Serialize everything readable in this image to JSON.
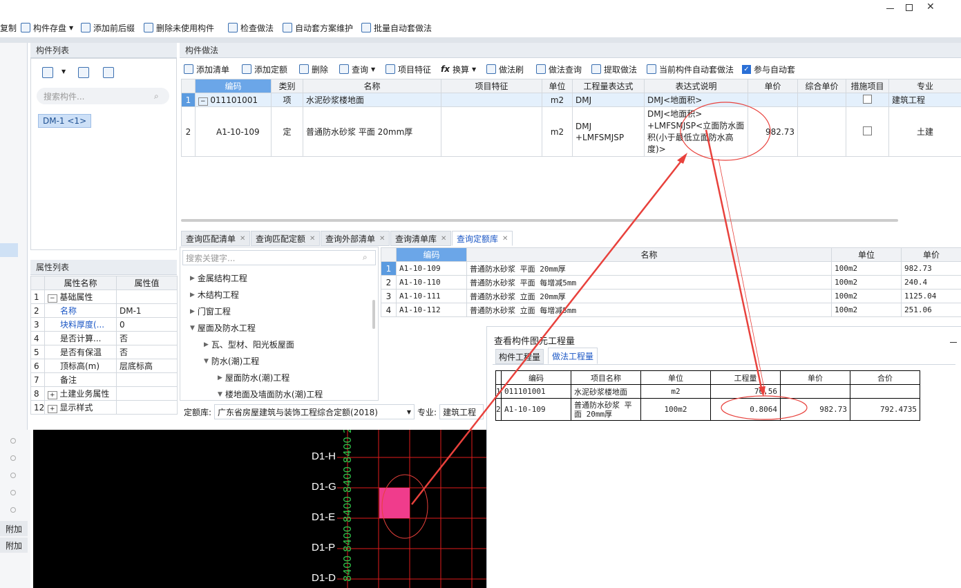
{
  "window": {
    "min_icon": "minimize-icon",
    "max_icon": "maximize-icon"
  },
  "toolbar": [
    "复制",
    "构件存盘",
    "添加前后缀",
    "删除未使用构件",
    "检查做法",
    "自动套方案维护",
    "批量自动套做法"
  ],
  "component_list": {
    "title": "构件列表",
    "search_placeholder": "搜索构件...",
    "item": "DM-1 <1>"
  },
  "properties": {
    "title": "属性列表",
    "col_name": "属性名称",
    "col_value": "属性值",
    "rows": [
      {
        "no": "1",
        "name": "基础属性",
        "value": ""
      },
      {
        "no": "2",
        "name": "名称",
        "value": "DM-1"
      },
      {
        "no": "3",
        "name": "块料厚度(...",
        "value": "0"
      },
      {
        "no": "4",
        "name": "是否计算...",
        "value": "否"
      },
      {
        "no": "5",
        "name": "是否有保温",
        "value": "否"
      },
      {
        "no": "6",
        "name": "顶标高(m)",
        "value": "层底标高"
      },
      {
        "no": "7",
        "name": "备注",
        "value": ""
      },
      {
        "no": "8",
        "name": "土建业务属性",
        "value": ""
      },
      {
        "no": "12",
        "name": "显示样式",
        "value": ""
      }
    ]
  },
  "method": {
    "title": "构件做法",
    "toolbar": [
      "添加清单",
      "添加定额",
      "删除",
      "查询",
      "项目特征",
      "换算",
      "做法刷",
      "做法查询",
      "提取做法",
      "当前构件自动套做法",
      "参与自动套"
    ],
    "headers": [
      "编码",
      "类别",
      "名称",
      "项目特征",
      "单位",
      "工程量表达式",
      "表达式说明",
      "单价",
      "综合单价",
      "措施项目",
      "专业"
    ],
    "rows": [
      {
        "no": "1",
        "code": "011101001",
        "type": "项",
        "name": "水泥砂浆楼地面",
        "feature": "",
        "unit": "m2",
        "expr": "DMJ",
        "desc": "DMJ<地面积>",
        "price": "",
        "comp": "",
        "spec": "建筑工程"
      },
      {
        "no": "2",
        "code": "A1-10-109",
        "type": "定",
        "name": "普通防水砂浆 平面 20mm厚",
        "feature": "",
        "unit": "m2",
        "expr": "DMJ +LMFSMJSP",
        "desc": "DMJ<地面积> +LMFSMJSP<立面防水面积(小于最低立面防水高度)>",
        "price": "982.73",
        "comp": "",
        "spec": "土建"
      }
    ]
  },
  "query_tabs": [
    "查询匹配清单",
    "查询匹配定额",
    "查询外部清单",
    "查询清单库",
    "查询定额库"
  ],
  "tree": {
    "search_placeholder": "搜索关键字...",
    "items": [
      "金属结构工程",
      "木结构工程",
      "门窗工程",
      "屋面及防水工程",
      "瓦、型材、阳光板屋面",
      "防水(潮)工程",
      "屋面防水(潮)工程",
      "楼地面及墙面防水(潮)工程"
    ],
    "library_label": "定额库:",
    "library_value": "广东省房屋建筑与装饰工程综合定额(2018)",
    "spec_label": "专业:",
    "spec_value": "建筑工程"
  },
  "quota_lib": {
    "headers": [
      "编码",
      "名称",
      "单位",
      "单价"
    ],
    "rows": [
      {
        "no": "1",
        "code": "A1-10-109",
        "name": "普通防水砂浆 平面 20mm厚",
        "unit": "100m2",
        "price": "982.73"
      },
      {
        "no": "2",
        "code": "A1-10-110",
        "name": "普通防水砂浆 平面 每增减5mm",
        "unit": "100m2",
        "price": "240.4"
      },
      {
        "no": "3",
        "code": "A1-10-111",
        "name": "普通防水砂浆 立面 20mm厚",
        "unit": "100m2",
        "price": "1125.04"
      },
      {
        "no": "4",
        "code": "A1-10-112",
        "name": "普通防水砂浆 立面 每增减5mm",
        "unit": "100m2",
        "price": "251.06"
      }
    ]
  },
  "quantity_dialog": {
    "title": "查看构件图元工程量",
    "tab1": "构件工程量",
    "tab2": "做法工程量",
    "headers": [
      "编码",
      "项目名称",
      "单位",
      "工程量",
      "单价",
      "合价"
    ],
    "rows": [
      {
        "no": "1",
        "code": "011101001",
        "name": "水泥砂浆楼地面",
        "unit": "m2",
        "qty": "76.56",
        "price": "",
        "total": ""
      },
      {
        "no": "2",
        "code": "A1-10-109",
        "name": "普通防水砂浆 平面 20mm厚",
        "unit": "100m2",
        "qty": "0.8064",
        "price": "982.73",
        "total": "792.4735"
      }
    ]
  },
  "left_strip": {
    "btn1": "附加",
    "btn2": "附加"
  },
  "cad": {
    "labels": [
      "D1-H",
      "D1-G",
      "D1-E",
      "D1-P",
      "D1-D"
    ],
    "dims": "8400 8400 8400 8400 8400 2100"
  },
  "colors": {
    "accent": "#3b78c8",
    "highlight": "#f03c8c",
    "annotation": "#e8413c",
    "grid_line": "#e21b1b"
  }
}
